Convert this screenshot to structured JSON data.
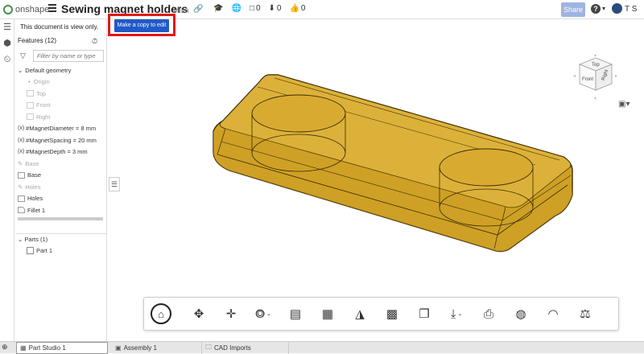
{
  "app": {
    "brand": "onshape"
  },
  "document": {
    "title": "Sewing magnet holders",
    "branch": "Main"
  },
  "top_icons": [
    {
      "icon": "graduation-cap-icon",
      "label": ""
    },
    {
      "icon": "globe-icon",
      "label": ""
    },
    {
      "icon": "notification-box-icon",
      "label": "0"
    },
    {
      "icon": "download-icon",
      "label": "0"
    },
    {
      "icon": "like-icon",
      "label": "0"
    }
  ],
  "header": {
    "share_label": "Share",
    "help_label": "?",
    "user_initials": "T S"
  },
  "banner": {
    "view_only_text": "This document is view only.",
    "copy_button_label": "Make a copy to edit"
  },
  "features": {
    "header": "Features (12)",
    "filter_placeholder": "Filter by name or type",
    "items": [
      {
        "label": "Default geometry",
        "kind": "group"
      },
      {
        "label": "Origin",
        "kind": "origin",
        "dim": true
      },
      {
        "label": "Top",
        "kind": "plane",
        "dim": true
      },
      {
        "label": "Front",
        "kind": "plane",
        "dim": true
      },
      {
        "label": "Right",
        "kind": "plane",
        "dim": true
      },
      {
        "label": "#MagnetDiameter = 8 mm",
        "kind": "variable"
      },
      {
        "label": "#MagnetSpacing = 20 mm",
        "kind": "variable"
      },
      {
        "label": "#MagnetDepth = 3 mm",
        "kind": "variable"
      },
      {
        "label": "Base",
        "kind": "sketch",
        "dim": true
      },
      {
        "label": "Base",
        "kind": "extrude"
      },
      {
        "label": "Holes",
        "kind": "sketch",
        "dim": true
      },
      {
        "label": "Holes",
        "kind": "extrude"
      },
      {
        "label": "Fillet 1",
        "kind": "fillet"
      }
    ]
  },
  "parts": {
    "header": "Parts (1)",
    "items": [
      "Part 1"
    ]
  },
  "viewcube": {
    "top": "Top",
    "front": "Front",
    "right": "Right"
  },
  "toolbar": [
    {
      "icon": "home-icon"
    },
    {
      "icon": "rotate-view-icon"
    },
    {
      "icon": "pan-icon"
    },
    {
      "icon": "zoom-icon",
      "has_menu": true
    },
    {
      "icon": "section-view-icon"
    },
    {
      "icon": "named-views-icon"
    },
    {
      "icon": "measure-icon"
    },
    {
      "icon": "appearance-icon"
    },
    {
      "icon": "explode-icon"
    },
    {
      "icon": "export-icon",
      "has_menu": true
    },
    {
      "icon": "print-icon"
    },
    {
      "icon": "tape-measure-icon"
    },
    {
      "icon": "protractor-icon"
    },
    {
      "icon": "mass-properties-icon"
    }
  ],
  "tabs": [
    {
      "label": "Part Studio 1",
      "active": true
    },
    {
      "label": "Assembly 1",
      "active": false
    },
    {
      "label": "CAD Imports",
      "active": false
    }
  ],
  "colors": {
    "model_fill": "#d4a628",
    "model_edge": "#3a2c05",
    "highlight": "#e01818",
    "button_blue": "#2159c7"
  }
}
